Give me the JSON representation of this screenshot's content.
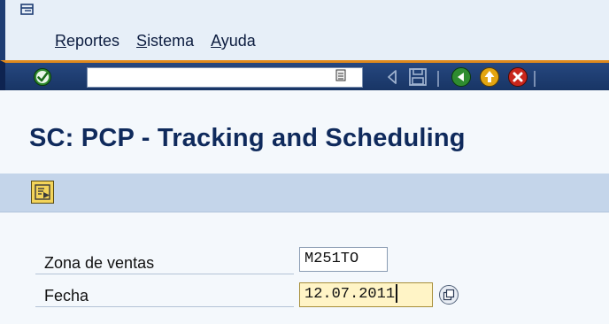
{
  "menu": {
    "items": [
      {
        "mnemonic": "R",
        "rest": "eportes"
      },
      {
        "mnemonic": "S",
        "rest": "istema"
      },
      {
        "mnemonic": "A",
        "rest": "yuda"
      }
    ]
  },
  "toolbar": {
    "command_field_value": "",
    "icons": [
      "enter-icon",
      "dropdown-icon",
      "back-arrow-icon",
      "save-icon",
      "back-icon",
      "exit-icon",
      "cancel-icon"
    ]
  },
  "page": {
    "title": "SC: PCP - Tracking and Scheduling"
  },
  "app_toolbar": {
    "icons": [
      "execute-icon"
    ]
  },
  "form": {
    "sales_zone_label": "Zona de ventas",
    "sales_zone_value": "M251TO",
    "date_label": "Fecha",
    "date_value": "12.07.2011"
  },
  "colors": {
    "menu_bg": "#e7eff8",
    "toolbar_bg": "#26477f",
    "toolbar_accent": "#e08a1d",
    "app_toolbar_bg": "#c4d5ea",
    "focused_field_bg": "#fff4c6",
    "title_color": "#0f2a5c"
  }
}
